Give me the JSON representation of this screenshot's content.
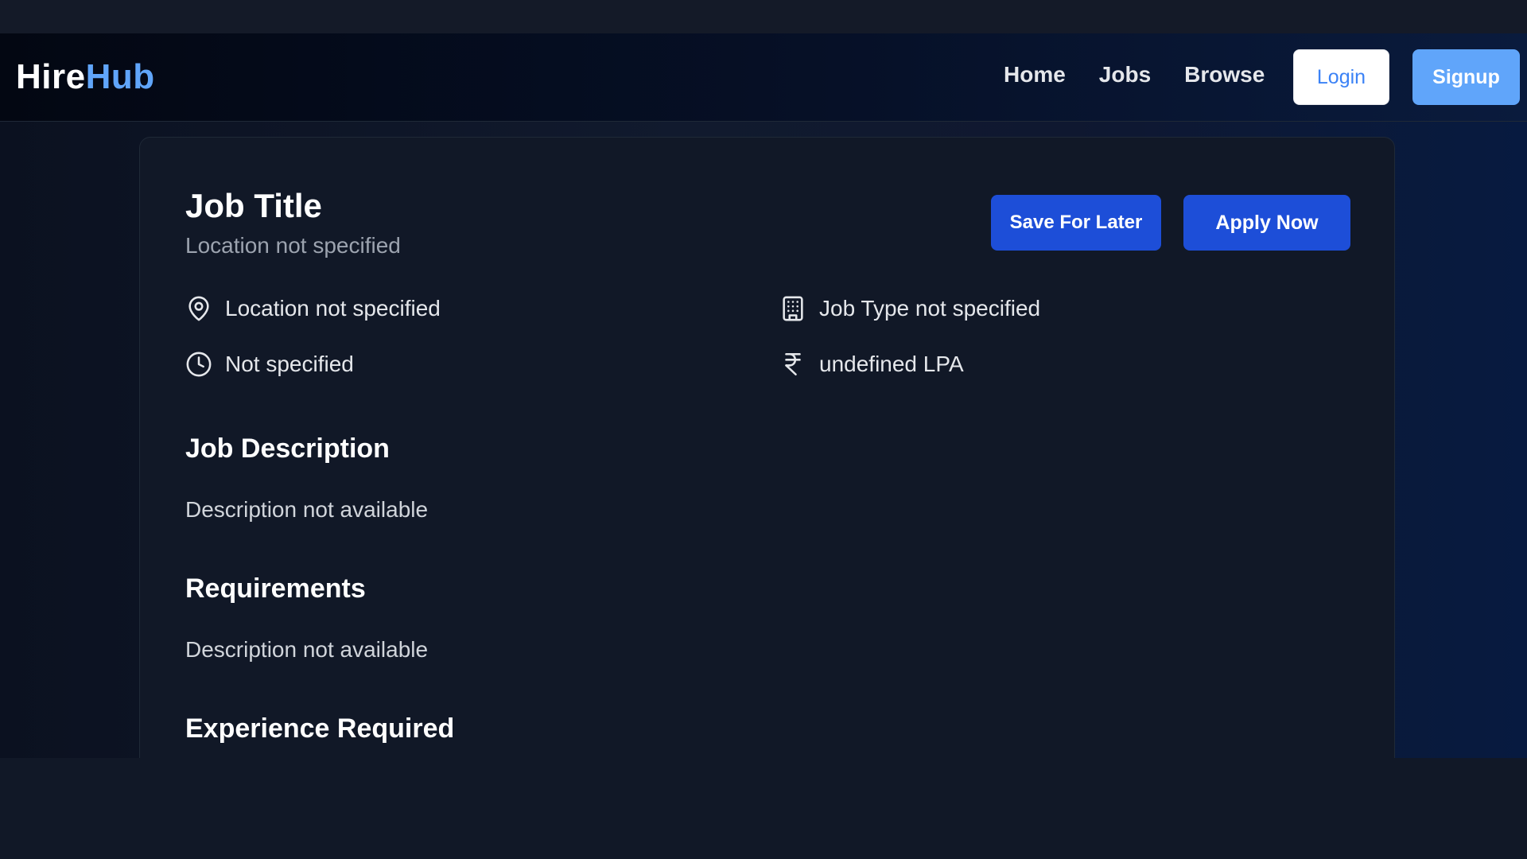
{
  "brand": {
    "part_a": "Hire",
    "part_b": "Hub"
  },
  "nav": {
    "links": [
      "Home",
      "Jobs",
      "Browse"
    ],
    "login_label": "Login",
    "signup_label": "Signup"
  },
  "job": {
    "title": "Job Title",
    "subtitle": "Location not specified",
    "save_label": "Save For Later",
    "apply_label": "Apply Now",
    "details": {
      "location": "Location not specified",
      "duration": "Not specified",
      "job_type": "Job Type not specified",
      "salary": "undefined LPA"
    },
    "sections": {
      "description_heading": "Job Description",
      "description_text": "Description not available",
      "requirements_heading": "Requirements",
      "requirements_text": "Description not available",
      "experience_heading": "Experience Required"
    }
  },
  "colors": {
    "accent": "#60a5fa",
    "primary_button": "#1d4ed8",
    "card_bg": "#111827"
  },
  "icons": {
    "location": "map-pin-icon",
    "duration": "clock-icon",
    "job_type": "building-icon",
    "salary": "rupee-icon"
  }
}
